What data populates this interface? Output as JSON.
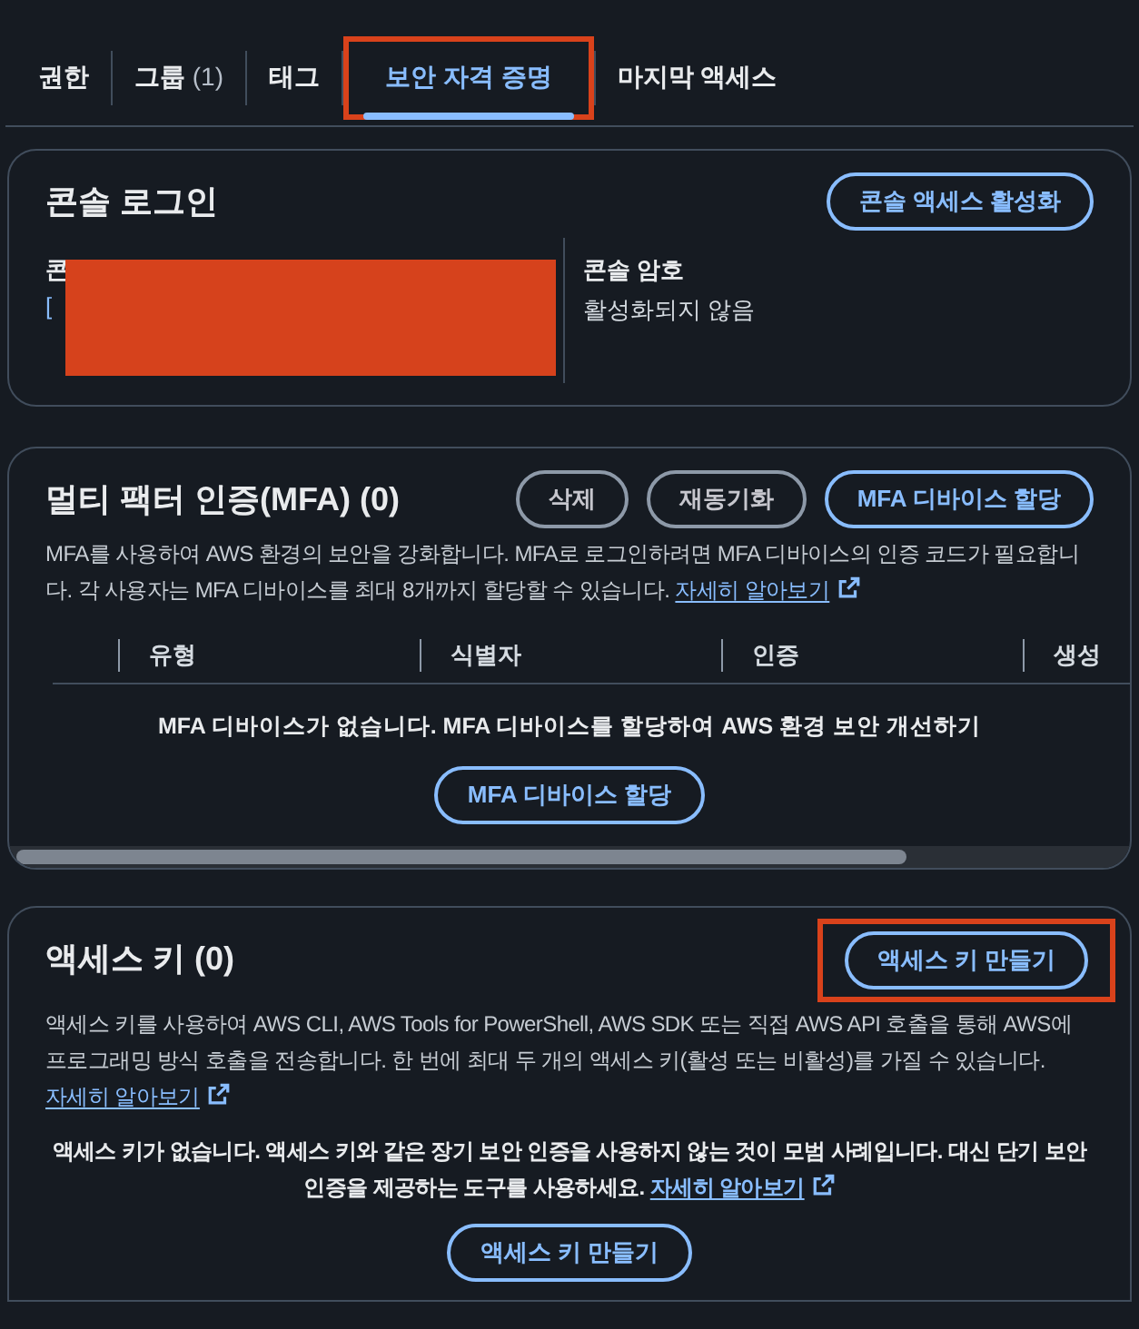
{
  "tabs": [
    {
      "label": "권한",
      "selected": false,
      "highlighted": false
    },
    {
      "label": "그룹",
      "count": "(1)",
      "selected": false,
      "highlighted": false
    },
    {
      "label": "태그",
      "selected": false,
      "highlighted": false
    },
    {
      "label": "보안 자격 증명",
      "selected": true,
      "highlighted": true
    },
    {
      "label": "마지막 액세스",
      "selected": false,
      "highlighted": false
    }
  ],
  "console_login": {
    "title": "콘솔 로그인",
    "button": "콘솔 액세스 활성화",
    "left": {
      "label": "콘",
      "value": "[",
      "redacted": true
    },
    "right": {
      "label": "콘솔 암호",
      "value": "활성화되지 않음"
    }
  },
  "mfa": {
    "title": "멀티 팩터 인증(MFA) (0)",
    "buttons": [
      {
        "label": "삭제",
        "kind": "normal"
      },
      {
        "label": "재동기화",
        "kind": "normal"
      },
      {
        "label": "MFA 디바이스 할당",
        "kind": "primary"
      }
    ],
    "description": "MFA를 사용하여 AWS 환경의 보안을 강화합니다. MFA로 로그인하려면 MFA 디바이스의 인증 코드가 필요합니다. 각 사용자는 MFA 디바이스를 최대 8개까지 할당할 수 있습니다.",
    "learn_more": "자세히 알아보기",
    "columns": [
      "유형",
      "식별자",
      "인증",
      "생성"
    ],
    "empty_message": "MFA 디바이스가 없습니다. MFA 디바이스를 할당하여 AWS 환경 보안 개선하기",
    "empty_button": "MFA 디바이스 할당"
  },
  "access_keys": {
    "title": "액세스 키 (0)",
    "button": "액세스 키 만들기",
    "button_highlighted": true,
    "description": "액세스 키를 사용하여 AWS CLI, AWS Tools for PowerShell, AWS SDK 또는 직접 AWS API 호출을 통해 AWS에 프로그래밍 방식 호출을 전송합니다. 한 번에 최대 두 개의 액세스 키(활성 또는 비활성)를 가질 수 있습니다.",
    "learn_more": "자세히 알아보기",
    "empty_message": "액세스 키가 없습니다. 액세스 키와 같은 장기 보안 인증을 사용하지 않는 것이 모범 사례입니다. 대신 단기 보안 인증을 제공하는 도구를 사용하세요.",
    "empty_learn_more": "자세히 알아보기",
    "empty_button": "액세스 키 만들기"
  }
}
